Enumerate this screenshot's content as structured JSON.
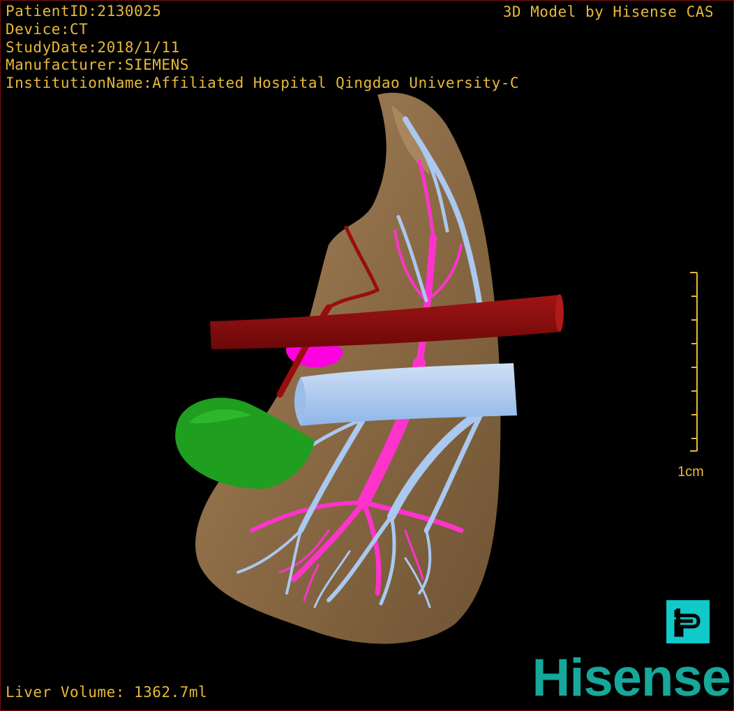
{
  "overlay": {
    "patient_id": "PatientID:2130025",
    "device": "Device:CT",
    "study_date": "StudyDate:2018/1/11",
    "manufacturer": "Manufacturer:SIEMENS",
    "institution": "InstitutionName:Affiliated Hospital Qingdao University-C",
    "credit": "3D Model by Hisense CAS",
    "liver_volume": "Liver Volume: 1362.7ml"
  },
  "scale": {
    "label": "1cm"
  },
  "brand": {
    "name": "Hisense"
  },
  "controls": {
    "projection_icon": "p-icon"
  },
  "colors": {
    "overlay_text": "#e8b93a",
    "liver": "#8a6a44",
    "hepatic_artery": "#8b0a0a",
    "portal_vein": "#ff33cc",
    "hepatic_vein": "#aac8f0",
    "lesion": "#1f9e1f",
    "accent": "#10c9c9",
    "brand": "#16a89a"
  }
}
